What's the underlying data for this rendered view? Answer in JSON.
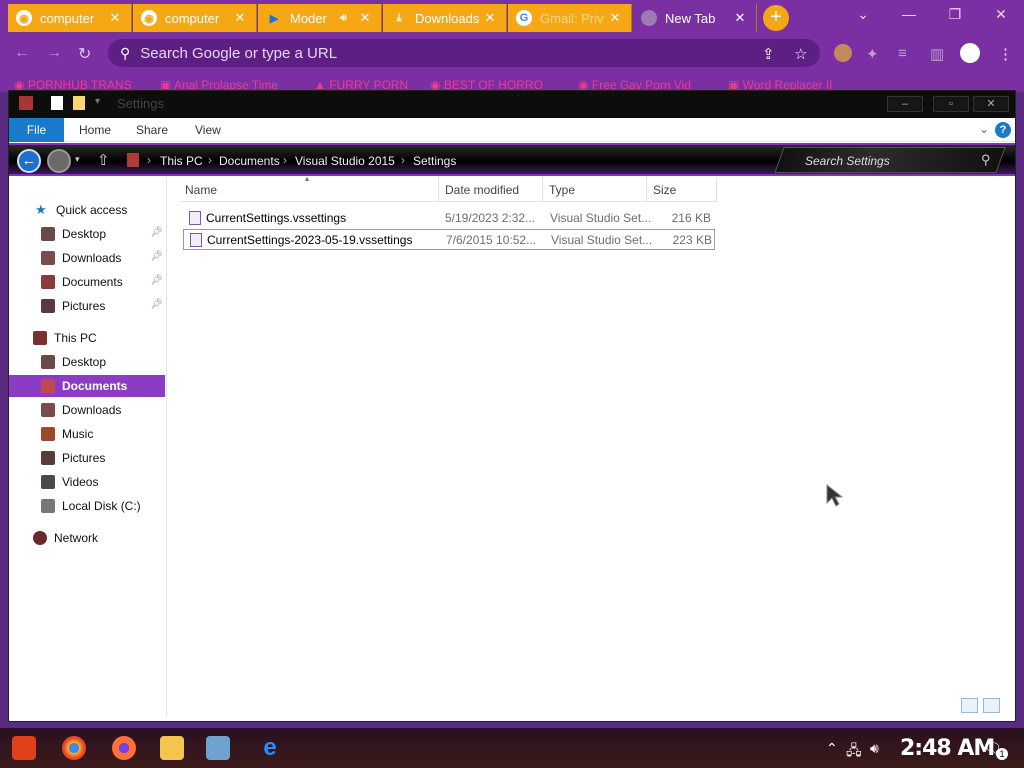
{
  "browser": {
    "tabs": [
      {
        "title": "computer",
        "icon": "web-icon"
      },
      {
        "title": "computer",
        "icon": "web-icon"
      },
      {
        "title": "Moder",
        "icon": "bing-icon"
      },
      {
        "title": "Downloads",
        "icon": "download-icon"
      },
      {
        "title": "Gmail: Priv",
        "icon": "google-icon"
      },
      {
        "title": "New Tab",
        "icon": "chrome-icon",
        "active": true
      }
    ],
    "omnibox_placeholder": "Search Google or type a URL",
    "bookmarks": [
      "PORNHUB TRANS",
      "Anal Prolapse Time",
      "FURRY PORN",
      "BEST OF HORRO",
      "Free Gay Porn Vid",
      "Word Replacer II"
    ]
  },
  "explorer": {
    "title": "Settings",
    "ribbon_tabs": [
      "File",
      "Home",
      "Share",
      "View"
    ],
    "breadcrumb": [
      "This PC",
      "Documents",
      "Visual Studio 2015",
      "Settings"
    ],
    "search_placeholder": "Search Settings",
    "nav": {
      "quick_access": "Quick access",
      "quick_items": [
        "Desktop",
        "Downloads",
        "Documents",
        "Pictures"
      ],
      "this_pc": "This PC",
      "pc_items": [
        "Desktop",
        "Documents",
        "Downloads",
        "Music",
        "Pictures",
        "Videos",
        "Local Disk (C:)"
      ],
      "network": "Network",
      "selected": "Documents"
    },
    "columns": [
      "Name",
      "Date modified",
      "Type",
      "Size"
    ],
    "files": [
      {
        "name": "CurrentSettings.vssettings",
        "date": "5/19/2023 2:32...",
        "type": "Visual Studio Set...",
        "size": "216 KB"
      },
      {
        "name": "CurrentSettings-2023-05-19.vssettings",
        "date": "7/6/2015 10:52...",
        "type": "Visual Studio Set...",
        "size": "223 KB"
      }
    ]
  },
  "taskbar": {
    "clock": "2:48 AM",
    "notification_count": "1"
  },
  "colors": {
    "accent_purple": "#8b3cc4",
    "tab_orange": "#f5a814",
    "ribbon_blue": "#1979ca"
  }
}
